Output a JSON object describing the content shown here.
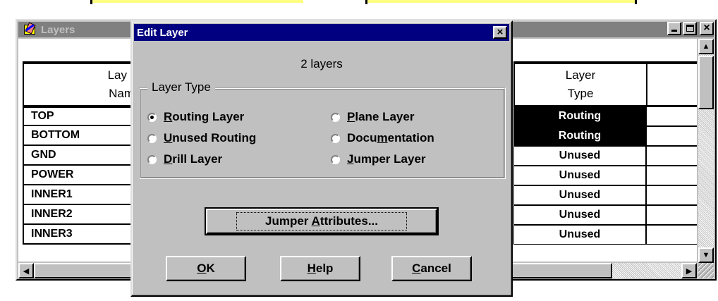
{
  "layers_window": {
    "title": "Layers",
    "header": {
      "name_line1": "Lay",
      "name_line2": "Nam",
      "type_line1": "Layer",
      "type_line2": "Type"
    },
    "rows": [
      {
        "name": "TOP",
        "type": "Routing",
        "selected": true
      },
      {
        "name": "BOTTOM",
        "type": "Routing",
        "selected": true
      },
      {
        "name": "GND",
        "type": "Unused",
        "selected": false
      },
      {
        "name": "POWER",
        "type": "Unused",
        "selected": false
      },
      {
        "name": "INNER1",
        "type": "Unused",
        "selected": false
      },
      {
        "name": "INNER2",
        "type": "Unused",
        "selected": false
      },
      {
        "name": "INNER3",
        "type": "Unused",
        "selected": false
      }
    ]
  },
  "dialog": {
    "title": "Edit Layer",
    "close": "×",
    "subtitle": "2 layers",
    "group_label": "Layer Type",
    "radios": {
      "routing": {
        "pre": "",
        "u": "R",
        "post": "outing Layer",
        "checked": true
      },
      "unused": {
        "pre": "",
        "u": "U",
        "post": "nused Routing",
        "checked": false
      },
      "drill": {
        "pre": "",
        "u": "D",
        "post": "rill Layer",
        "checked": false
      },
      "plane": {
        "pre": "",
        "u": "P",
        "post": "lane Layer",
        "checked": false
      },
      "documentation": {
        "pre": "Docu",
        "u": "m",
        "post": "entation",
        "checked": false
      },
      "jumper": {
        "pre": "",
        "u": "J",
        "post": "umper Layer",
        "checked": false
      }
    },
    "jumper_btn": {
      "pre": "Jumper ",
      "u": "A",
      "post": "ttributes..."
    },
    "ok_btn": {
      "pre": "",
      "u": "O",
      "post": "K"
    },
    "help_btn": {
      "pre": "",
      "u": "H",
      "post": "elp"
    },
    "cancel_btn": {
      "pre": "",
      "u": "C",
      "post": "ancel"
    }
  }
}
